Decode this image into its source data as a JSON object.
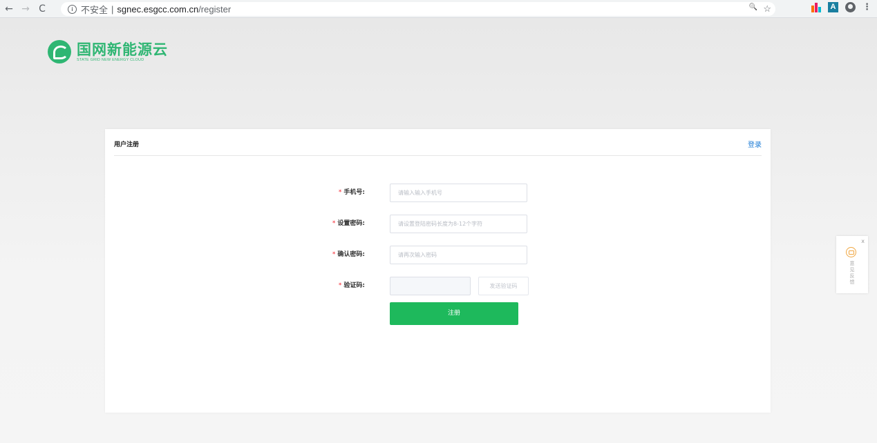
{
  "browser": {
    "back_glyph": "←",
    "forward_glyph": "→",
    "reload_glyph": "C",
    "info_glyph": "i",
    "security_label": "不安全",
    "separator": "|",
    "url_host": "sgnec.esgcc.com.cn",
    "url_path": "/register",
    "zoom_glyph": "🔍",
    "star_glyph": "☆",
    "extension_a_label": "A",
    "menu_glyph": "⋮",
    "icons": [
      "back-icon",
      "forward-icon",
      "reload-icon",
      "info-icon",
      "zoom-icon",
      "star-icon",
      "extension-icon",
      "profile-icon",
      "menu-icon"
    ],
    "extension_colors": [
      "#ff6f00",
      "#e91e63",
      "#00bcd4"
    ]
  },
  "logo": {
    "name_cn": "国网新能源云",
    "name_en": "STATE GRID NEW ENERGY CLOUD",
    "color": "#2fb673"
  },
  "card": {
    "title": "用户注册",
    "login_link": "登录"
  },
  "form": {
    "required_mark": "*",
    "phone": {
      "label": "手机号:",
      "placeholder": "请输入输入手机号"
    },
    "password": {
      "label": "设置密码:",
      "placeholder": "请设置登陆密码长度为8-12个字符"
    },
    "confirm": {
      "label": "确认密码:",
      "placeholder": "请再次输入密码"
    },
    "code": {
      "label": "验证码:",
      "placeholder": "",
      "send_label": "发送验证码"
    },
    "submit_label": "注册",
    "accent_color": "#1eb95c",
    "required_color": "#f5222d"
  },
  "feedback": {
    "close": "x",
    "chars": [
      "意",
      "见",
      "反",
      "馈"
    ],
    "icon": "mail-icon",
    "icon_color": "#f0a640"
  }
}
